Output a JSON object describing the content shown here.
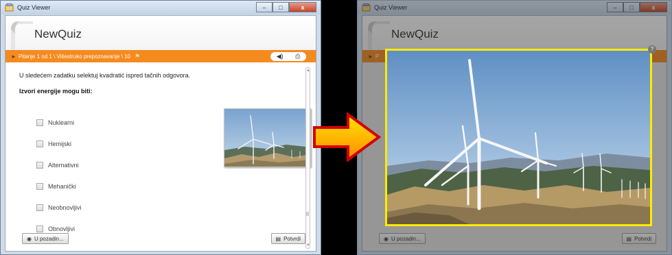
{
  "window": {
    "title": "Quiz Viewer",
    "close_glyph": "x"
  },
  "quiz": {
    "title": "NewQuiz",
    "breadcrumb": "Pitanje 1 od 1 \\ Višestruko prepoznavanje \\ 10",
    "breadcrumb_short": "P",
    "instruction": "U sledećem zadatku selektuj kvadratić ispred tačnih odgovora.",
    "question": "Izvori energije mogu biti:",
    "answers": [
      {
        "label": "Nuklearni"
      },
      {
        "label": "Hemijski"
      },
      {
        "label": "Alternativni"
      },
      {
        "label": "Mehanički"
      },
      {
        "label": "Neobnovljivi"
      },
      {
        "label": "Obnovljivi"
      }
    ]
  },
  "buttons": {
    "back_label": "U pozadin...",
    "confirm_label": "Potvrdi"
  },
  "icons": {
    "breadcrumb": "chevron-right-icon",
    "flag": "flag-icon",
    "sound": "speaker-icon",
    "print": "printer-icon",
    "back": "circle-arrow-icon",
    "confirm": "list-icon",
    "arrow": "arrow-right-icon"
  },
  "colors": {
    "accent": "#f58a1f",
    "highlight_frame": "#ffea00",
    "arrow_fill_top": "#ffe600",
    "arrow_fill_bottom": "#ff8a00",
    "arrow_outline": "#d40000"
  }
}
